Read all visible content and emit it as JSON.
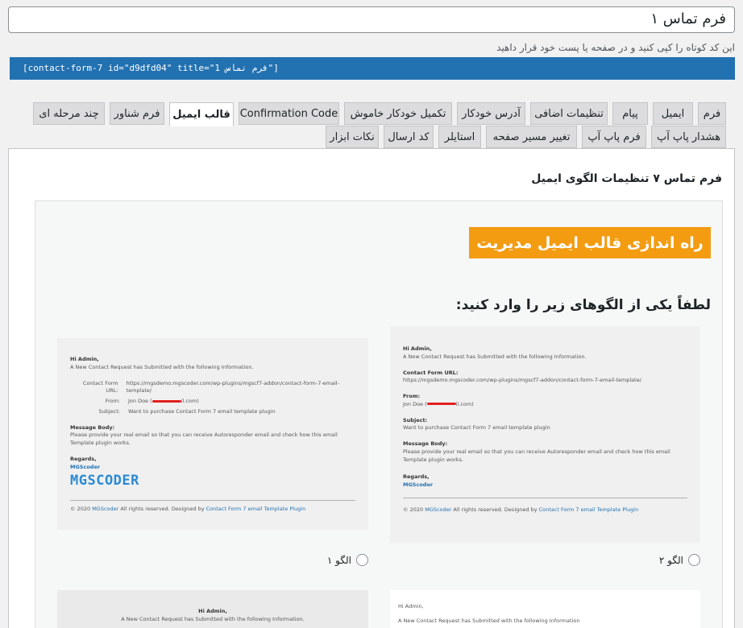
{
  "form_title": "فرم تماس ۱",
  "shortcode_note": "این کد کوتاه را کپی کنید و در صفحه یا پست خود قرار داهید",
  "shortcode": "[contact-form-7 id=\"d9dfd04\" title=\"فرم تماس 1\"]",
  "tabs_row1": [
    "فرم",
    "ایمیل",
    "پیام",
    "تنظیمات اضافی",
    "آدرس خودکار",
    "تکمیل خودکار خاموش",
    "Confirmation Code",
    "قالب ایمیل",
    "فرم شناور",
    "چند مرحله ای"
  ],
  "tabs_row2": [
    "هشدار پاپ آپ",
    "فرم پاپ آپ",
    "تغییر مسیر صفحه",
    "استایلر",
    "کد ارسال",
    "نکات ابزار"
  ],
  "active_tab": "قالب ایمیل",
  "section_title": "فرم تماس ۷ تنظیمات الگوی ایمیل",
  "banner": "راه اندازی قالب ایمیل مدیریت",
  "prompt": "لطفاً یکی از الگوهای زیر را وارد کنید:",
  "template2": {
    "greeting": "Hi Admin,",
    "intro": "A New Contact Request has Submitted with the following Information.",
    "url_label": "Contact Form URL:",
    "url": "https://mgsdemo.mgscoder.com/wp-plugins/mgscf7-addon/contact-form-7-email-template/",
    "from_label": "From:",
    "from_name": "Jon Doe (",
    "from_suffix": "il.com)",
    "subject_label": "Subject:",
    "subject": "Want to purchase Contact Form 7 email template plugin",
    "body_label": "Message Body:",
    "body": "Please provide your real email so that you can receive Autoresponder email and check how this email Template plugin works.",
    "regards": "Regards,",
    "brand": "MGScoder",
    "footer_prefix": "© 2020",
    "footer_brand": "MGScoder",
    "footer_mid": "All rights reserved. Designed by",
    "footer_link": "Contact Form 7 email Template Plugin",
    "radio_label": "الگو ۲"
  },
  "template1": {
    "greeting": "Hi Admin,",
    "intro": "A New Contact Request has Submitted with the following Information.",
    "url_label": "Contact Form URL:",
    "url": "https://mgsdemo.mgscoder.com/wp-plugins/mgscf7-addon/contact-form-7-email-template/",
    "from_label": "From:",
    "from_name": "Jon Doe (",
    "from_suffix": "il.com)",
    "subject_label": "Subject:",
    "subject": "Want to purchase Contact Form 7 email template plugin",
    "body_label": "Message Body:",
    "body": "Please provide your real email so that you can receive Autoresponder email and check how this email Template plugin works.",
    "regards": "Regards,",
    "brand": "MGScoder",
    "logo": "MGSCODER",
    "footer_prefix": "© 2020",
    "footer_brand": "MGScoder",
    "footer_mid": "All rights reserved. Designed by",
    "footer_link": "Contact Form 7 email Template Plugin",
    "radio_label": "الگو ۱"
  },
  "template3": {
    "greeting": "Hi Admin,",
    "intro": "A New Contact Request has Submitted with the following Information."
  },
  "template4": {
    "greeting": "Hi Admin,",
    "intro": "A New Contact Request has Submitted with the following Information"
  }
}
